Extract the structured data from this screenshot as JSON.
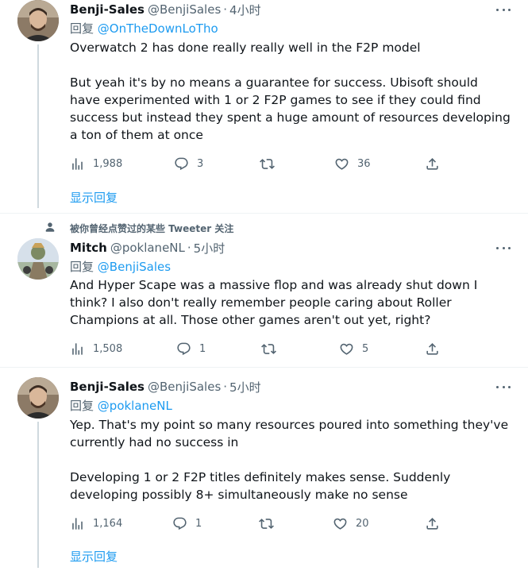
{
  "tweets": [
    {
      "name": "Benji-Sales",
      "handle": "@BenjiSales",
      "dot": "·",
      "time": "4小时",
      "reply_prefix": "回复",
      "reply_mention": "@OnTheDownLoTho",
      "text": "Overwatch 2 has done really really well in the F2P model\n\nBut yeah it's by no means a guarantee for success. Ubisoft should have experimented with 1 or 2 F2P games to see if they could find success but instead they spent a huge amount of resources developing a ton of them at once",
      "views": "1,988",
      "replies": "3",
      "retweets": "",
      "likes": "36",
      "show_replies": "显示回复"
    },
    {
      "name": "Mitch",
      "handle": "@poklaneNL",
      "dot": "·",
      "time": "5小时",
      "reply_prefix": "回复",
      "reply_mention": "@BenjiSales",
      "text": "And Hyper Scape was a massive flop and was already shut down I think? I also don't really remember people caring about Roller Champions at all. Those other games aren't out yet, right?",
      "views": "1,508",
      "replies": "1",
      "retweets": "",
      "likes": "5"
    },
    {
      "name": "Benji-Sales",
      "handle": "@BenjiSales",
      "dot": "·",
      "time": "5小时",
      "reply_prefix": "回复",
      "reply_mention": "@poklaneNL",
      "text": "Yep. That's my point so many resources poured into something they've currently had no success in\n\nDeveloping 1 or 2 F2P titles definitely makes sense. Suddenly developing possibly 8+ simultaneously make no sense",
      "views": "1,164",
      "replies": "1",
      "retweets": "",
      "likes": "20",
      "show_replies": "显示回复"
    }
  ],
  "social_context": "被你曾经点赞过的某些 Tweeter 关注",
  "icons": {
    "views": "analytics-icon",
    "reply": "reply-icon",
    "retweet": "retweet-icon",
    "like": "heart-icon",
    "share": "share-icon",
    "more": "more-icon",
    "context": "person-icon"
  },
  "colors": {
    "accent": "#1d9bf0",
    "secondary_text": "#536471",
    "thread_line": "#cfd9de"
  }
}
